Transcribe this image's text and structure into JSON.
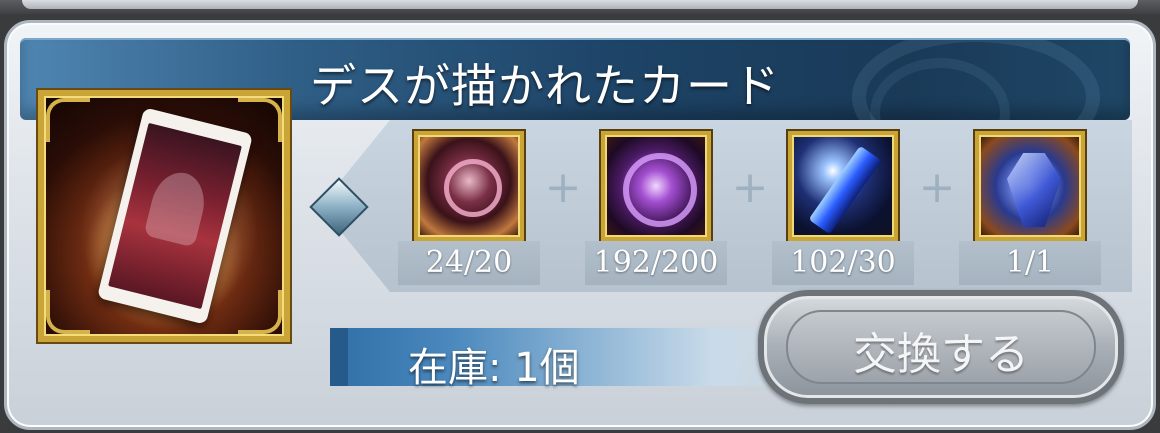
{
  "item": {
    "title": "デスが描かれたカード",
    "image": "death-tarot-card-icon"
  },
  "materials": [
    {
      "icon": "rose-sigil-icon",
      "count": "24/20"
    },
    {
      "icon": "purple-emblem-icon",
      "count": "192/200"
    },
    {
      "icon": "blue-crystal-icon",
      "count": "102/30"
    },
    {
      "icon": "blue-gem-icon",
      "count": "1/1"
    }
  ],
  "stock": {
    "label": "在庫: 1個"
  },
  "exchange_button": {
    "label": "交換する",
    "state": "disabled"
  },
  "colors": {
    "title_bar": "#1d4366",
    "frame_gold": "#c9a437",
    "panel": "#dfe4ea"
  }
}
